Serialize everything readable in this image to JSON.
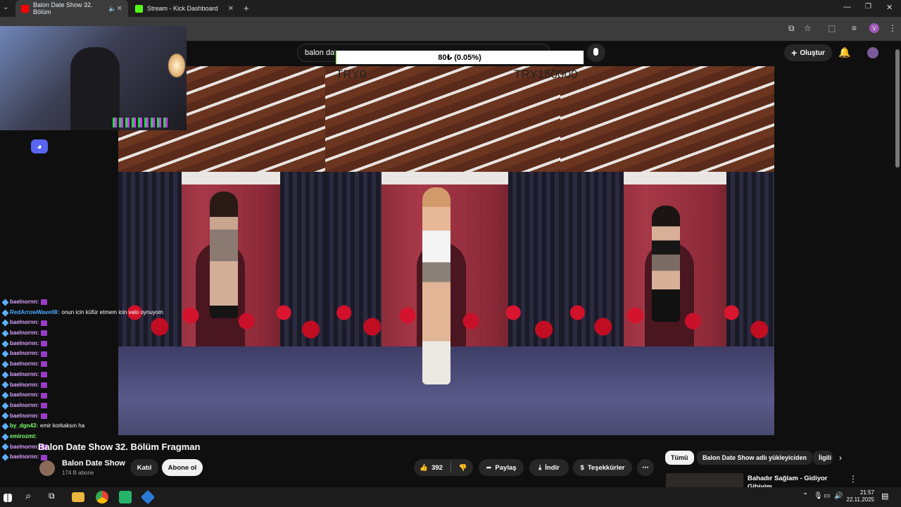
{
  "browser": {
    "tabs": [
      {
        "title": "Balon Date Show 32. Bölüm",
        "icon": "youtube-icon",
        "active": true
      },
      {
        "title": "Stream - Kick Dashboard",
        "icon": "kick-icon",
        "active": false
      }
    ],
    "new_tab": "+"
  },
  "youtube": {
    "search_value": "balon dat",
    "create_label": "Oluştur"
  },
  "donation": {
    "progress_label": "80₺ (0.05%)",
    "progress_fraction": 0.0005,
    "min_label": "TRY0",
    "max_label": "TRY150000"
  },
  "chat": {
    "messages": [
      {
        "user": "baelnornn:",
        "text": "",
        "user_color": "#d8a0ff",
        "emote": true
      },
      {
        "user": "RedArrowWave08:",
        "text": "onun icin küfür etmem icin valo oynuyom",
        "user_color": "#4aa8ff",
        "emote": false
      },
      {
        "user": "baelnornn:",
        "text": "",
        "user_color": "#d8a0ff",
        "emote": true
      },
      {
        "user": "baelnornn:",
        "text": "",
        "user_color": "#d8a0ff",
        "emote": true
      },
      {
        "user": "baelnornn:",
        "text": "",
        "user_color": "#d8a0ff",
        "emote": true
      },
      {
        "user": "baelnornn:",
        "text": "",
        "user_color": "#d8a0ff",
        "emote": true
      },
      {
        "user": "baelnornn:",
        "text": "",
        "user_color": "#d8a0ff",
        "emote": true
      },
      {
        "user": "baelnornn:",
        "text": "",
        "user_color": "#d8a0ff",
        "emote": true
      },
      {
        "user": "baelnornn:",
        "text": "",
        "user_color": "#d8a0ff",
        "emote": true
      },
      {
        "user": "baelnornn:",
        "text": "",
        "user_color": "#d8a0ff",
        "emote": true
      },
      {
        "user": "baelnornn:",
        "text": "",
        "user_color": "#d8a0ff",
        "emote": true
      },
      {
        "user": "baelnornn:",
        "text": "",
        "user_color": "#d8a0ff",
        "emote": true
      },
      {
        "user": "by_dgn43:",
        "text": "emir korkaksın ha",
        "user_color": "#7cff6b",
        "emote": false
      },
      {
        "user": "emirozmt:",
        "text": "",
        "user_color": "#7cff6b",
        "emote": false
      },
      {
        "user": "baelnornn:",
        "text": "",
        "user_color": "#d8a0ff",
        "emote": true
      },
      {
        "user": "baelnornn:",
        "text": "",
        "user_color": "#d8a0ff",
        "emote": true
      }
    ]
  },
  "video": {
    "title": "Balon Date Show 32. Bölüm Fragman",
    "channel": "Balon Date Show",
    "subscribers": "174 B abone",
    "join_label": "Katıl",
    "subscribe_label": "Abone ol",
    "likes": "392",
    "share_label": "Paylaş",
    "download_label": "İndir",
    "thanks_label": "Teşekkürler"
  },
  "sidebar": {
    "chips": [
      "Tümü",
      "Balon Date Show adlı yükleyiciden",
      "İlgili"
    ],
    "recommendation_title": "Bahadır Sağlam - Gidiyor Gibiyim"
  },
  "taskbar": {
    "time": "21:57",
    "date": "22.11.2025"
  },
  "colors": {
    "youtube_red": "#ff0000",
    "kick_green": "#53fc18",
    "discord_blurple": "#5865f2"
  }
}
